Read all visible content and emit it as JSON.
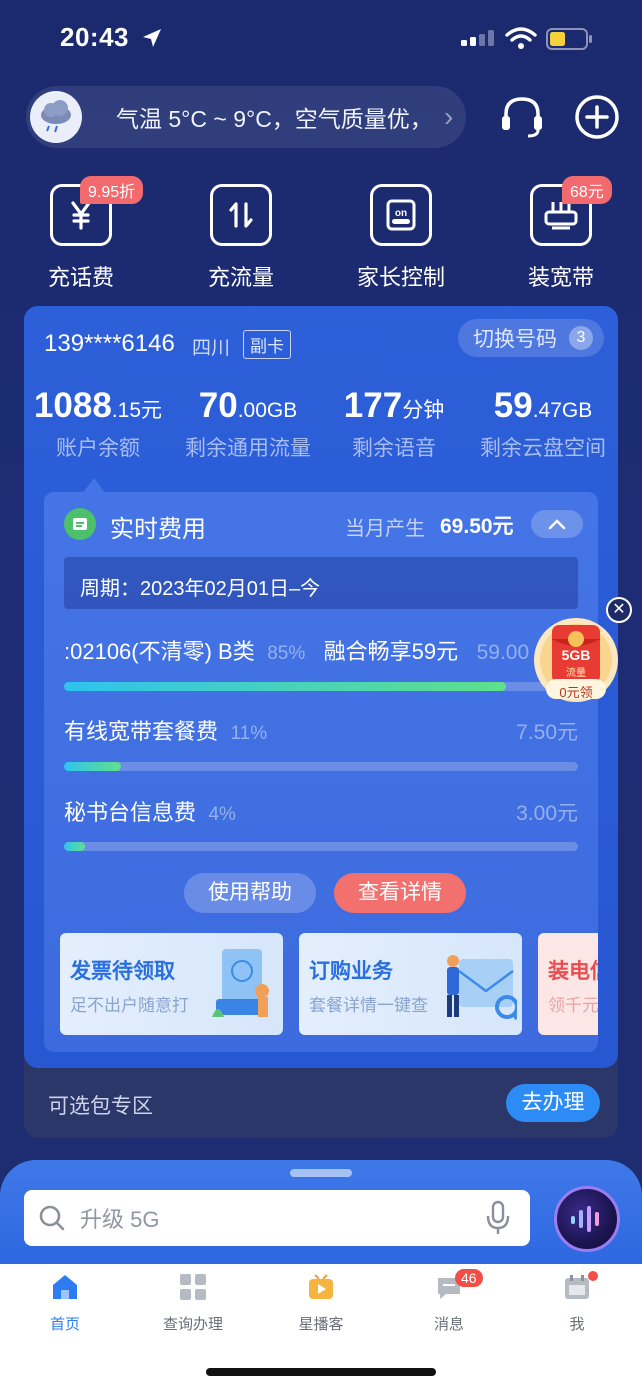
{
  "status": {
    "time": "20:43"
  },
  "topbar": {
    "weather_text": "气温 5°C ~ 9°C，空气质量优，",
    "chevron": "›"
  },
  "quick_actions": [
    {
      "label": "充话费",
      "badge": "9.95折"
    },
    {
      "label": "充流量",
      "badge": ""
    },
    {
      "label": "家长控制",
      "badge": ""
    },
    {
      "label": "装宽带",
      "badge": "68元"
    }
  ],
  "account": {
    "phone": "139****6146",
    "province": "四川",
    "card_tag": "副卡",
    "switch_label": "切换号码",
    "switch_count": "3"
  },
  "stats": [
    {
      "big": "1088",
      "small": ".15",
      "unit": "元",
      "label": "账户余额"
    },
    {
      "big": "70",
      "small": ".00",
      "unit": "GB",
      "label": "剩余通用流量"
    },
    {
      "big": "177",
      "small": "",
      "unit": "分钟",
      "label": "剩余语音"
    },
    {
      "big": "59",
      "small": ".47",
      "unit": "GB",
      "label": "剩余云盘空间"
    }
  ],
  "fee": {
    "title": "实时费用",
    "month_label": "当月产生",
    "month_value": "69.50元",
    "period": "周期：2023年02月01日–今",
    "items": [
      {
        "name": ":02106(不清零) B类",
        "pct_text": "85%",
        "pct": 0.86,
        "name2": "融合畅享59元",
        "amount": "59.00元"
      },
      {
        "name": "有线宽带套餐费",
        "pct_text": "11%",
        "pct": 0.11,
        "amount": "7.50元"
      },
      {
        "name": "秘书台信息费",
        "pct_text": "4%",
        "pct": 0.04,
        "amount": "3.00元"
      }
    ],
    "help_label": "使用帮助",
    "detail_label": "查看详情"
  },
  "promos": [
    {
      "title": "发票待领取",
      "subtitle": "足不出户随意打",
      "title_color": "#2a6fe0"
    },
    {
      "title": "订购业务",
      "subtitle": "套餐详情一键查",
      "title_color": "#2a6fe0"
    },
    {
      "title": "装电信",
      "subtitle": "领千元",
      "title_color": "#e94d4d"
    }
  ],
  "optional": {
    "label": "可选包专区",
    "button": "去办理"
  },
  "floating": {
    "gb": "5GB",
    "sub": "流量",
    "claim": "0元领"
  },
  "search": {
    "placeholder": "升级 5G"
  },
  "tabs": [
    {
      "label": "首页",
      "badge": ""
    },
    {
      "label": "查询办理",
      "badge": ""
    },
    {
      "label": "星播客",
      "badge": ""
    },
    {
      "label": "消息",
      "badge": "46"
    },
    {
      "label": "我",
      "badge": ""
    }
  ],
  "colors": {
    "accent": "#2d7cf2",
    "card_blue": "#2d5fd9",
    "danger": "#f2706e",
    "progress_start": "#2fc3ef",
    "progress_end": "#5fe08a"
  }
}
